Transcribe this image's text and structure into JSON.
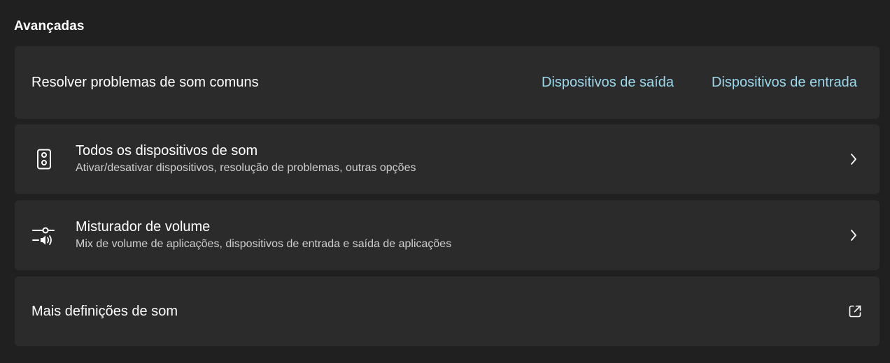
{
  "section": {
    "title": "Avançadas"
  },
  "troubleshoot": {
    "label": "Resolver problemas de som comuns",
    "output_link": "Dispositivos de saída",
    "input_link": "Dispositivos de entrada"
  },
  "all_devices": {
    "icon": "speaker-icon",
    "title": "Todos os dispositivos de som",
    "subtitle": "Ativar/desativar dispositivos, resolução de problemas, outras opções"
  },
  "mixer": {
    "icon": "volume-mixer-icon",
    "title": "Misturador de volume",
    "subtitle": "Mix de volume de aplicações, dispositivos de entrada e saída de aplicações"
  },
  "more": {
    "label": "Mais definições de som",
    "icon": "open-external-icon"
  },
  "colors": {
    "background": "#202020",
    "card": "#2b2b2b",
    "link": "#9ad8ec"
  }
}
